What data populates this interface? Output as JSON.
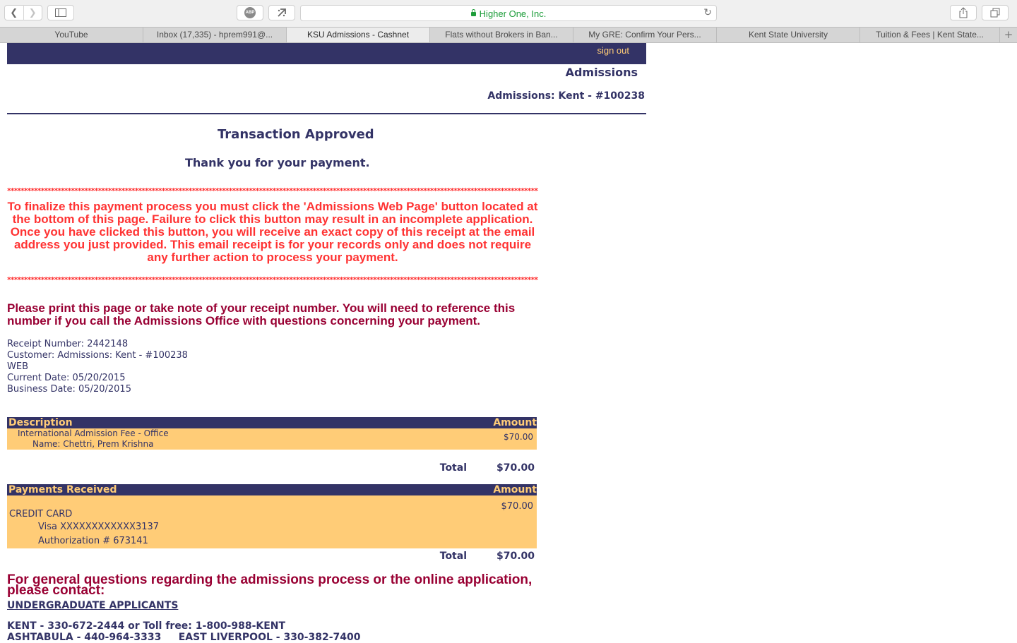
{
  "browser": {
    "address": "Higher One, Inc.",
    "abp_label": "ABP",
    "tabs": [
      {
        "label": "YouTube"
      },
      {
        "label": "Inbox (17,335) - hprem991@..."
      },
      {
        "label": "KSU Admissions - Cashnet"
      },
      {
        "label": "Flats without Brokers in Ban..."
      },
      {
        "label": "My GRE: Confirm Your Pers..."
      },
      {
        "label": "Kent State University"
      },
      {
        "label": "Tuition & Fees | Kent State..."
      }
    ],
    "active_tab": 2
  },
  "header": {
    "sign_out": "sign out",
    "title": "Admissions",
    "subtitle": "Admissions: Kent - #100238"
  },
  "status": {
    "title": "Transaction Approved",
    "thanks": "Thank you for your payment."
  },
  "stars": "*****************************************************************************************************************************************************************************",
  "warning": "To finalize this payment process you must click the 'Admissions Web Page' button located at the bottom of this page. Failure to click this button may result in an incomplete application. Once you have clicked this button, you will receive an exact copy of this receipt at the email address you just provided. This email receipt is for your records only and does not require any further action to process your payment.",
  "print_note": "Please print this page or take note of your receipt number. You will need to reference this number if you call the Admissions Office with questions concerning your payment.",
  "receipt": {
    "number": "Receipt Number: 2442148",
    "customer": "Customer: Admissions: Kent - #100238",
    "channel": "WEB",
    "current_date": "Current Date: 05/20/2015",
    "business_date": "Business Date: 05/20/2015"
  },
  "description_table": {
    "header_left": "Description",
    "header_right": "Amount",
    "item": "International Admission Fee - Office",
    "name": "Name: Chettri, Prem Krishna",
    "amount": "$70.00",
    "total_label": "Total",
    "total_value": "$70.00"
  },
  "payments_table": {
    "header_left": "Payments Received",
    "header_right": "Amount",
    "amount": "$70.00",
    "method": "CREDIT CARD",
    "card": "Visa XXXXXXXXXXXX3137",
    "auth": "Authorization # 673141",
    "total_label": "Total",
    "total_value": "$70.00"
  },
  "contact": {
    "heading": "For general questions regarding the admissions process or the online application, please contact:",
    "undergrad": "UNDERGRADUATE APPLICANTS",
    "kent": "KENT - 330-672-2444 or Toll free: 1-800-988-KENT",
    "ashtabula": "ASHTABULA - 440-964-3333     EAST LIVERPOOL - 330-382-7400"
  },
  "colors": {
    "navy": "#333366",
    "gold": "#ffcc77",
    "warning_red": "#ff3333",
    "maroon": "#990033",
    "secure_green": "#1d9d3a"
  }
}
